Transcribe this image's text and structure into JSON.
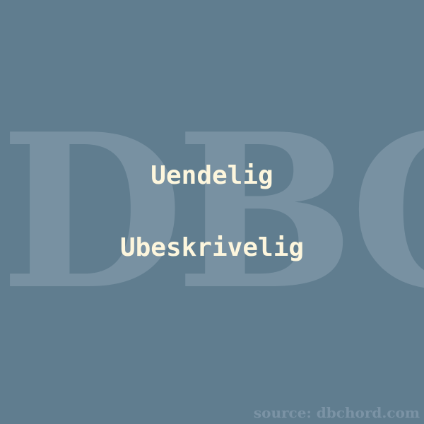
{
  "watermark": {
    "text": "DBC"
  },
  "lyrics": {
    "line1": "Uendelig",
    "line2": "Ubeskrivelig"
  },
  "footer": {
    "source": "source: dbchord.com"
  },
  "colors": {
    "background": "#607d8f",
    "text": "#fdf6dd",
    "watermark": "#7891a2",
    "source": "#7b93a5"
  }
}
